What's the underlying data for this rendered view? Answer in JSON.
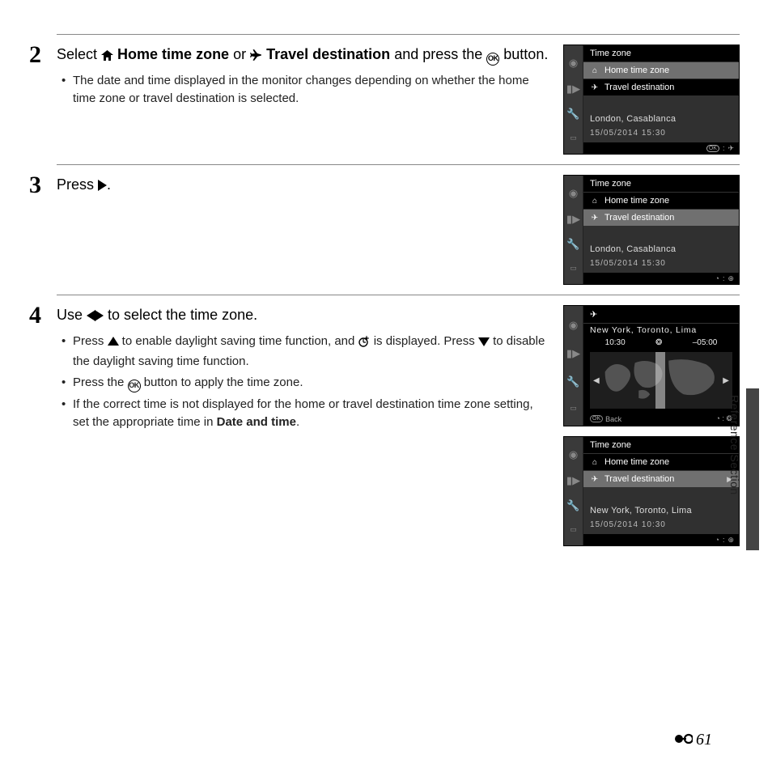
{
  "side_label": "Reference Section",
  "page_number": "61",
  "steps": {
    "s2": {
      "num": "2",
      "pre": "Select ",
      "opt1": "Home time zone",
      "mid": " or ",
      "opt2": "Travel destination",
      "post": " and press the ",
      "tail": " button.",
      "bullet1": "The date and time displayed in the monitor changes depending on whether the home time zone or travel destination is selected."
    },
    "s3": {
      "num": "3",
      "text": "Press "
    },
    "s4": {
      "num": "4",
      "pre": "Use ",
      "post": " to select the time zone.",
      "b1a": "Press ",
      "b1b": " to enable daylight saving time function, and ",
      "b1c": " is displayed. Press ",
      "b1d": " to disable the daylight saving time function.",
      "b2a": "Press the ",
      "b2b": " button to apply the time zone.",
      "b3a": "If the correct time is not displayed for the home or travel destination time zone setting, set the appropriate time in ",
      "b3bold": "Date and time",
      "b3c": "."
    }
  },
  "lcd_a": {
    "title": "Time zone",
    "item1": "Home time zone",
    "item2": "Travel destination",
    "loc": "London, Casablanca",
    "dt": "15/05/2014  15:30",
    "foot_ok": "OK",
    "foot_sym": "✈"
  },
  "lcd_b": {
    "title": "Time zone",
    "item1": "Home time zone",
    "item2": "Travel destination",
    "loc": "London, Casablanca",
    "dt": "15/05/2014  15:30",
    "foot_sym": "⊕"
  },
  "lcd_c": {
    "loc": "New York, Toronto, Lima",
    "t1": "10:30",
    "t2": "–05:00",
    "back": "Back",
    "foot_sym": "⊕"
  },
  "lcd_d": {
    "title": "Time zone",
    "item1": "Home time zone",
    "item2": "Travel destination",
    "loc": "New York, Toronto, Lima",
    "dt": "15/05/2014  10:30",
    "foot_sym": "⊕"
  }
}
